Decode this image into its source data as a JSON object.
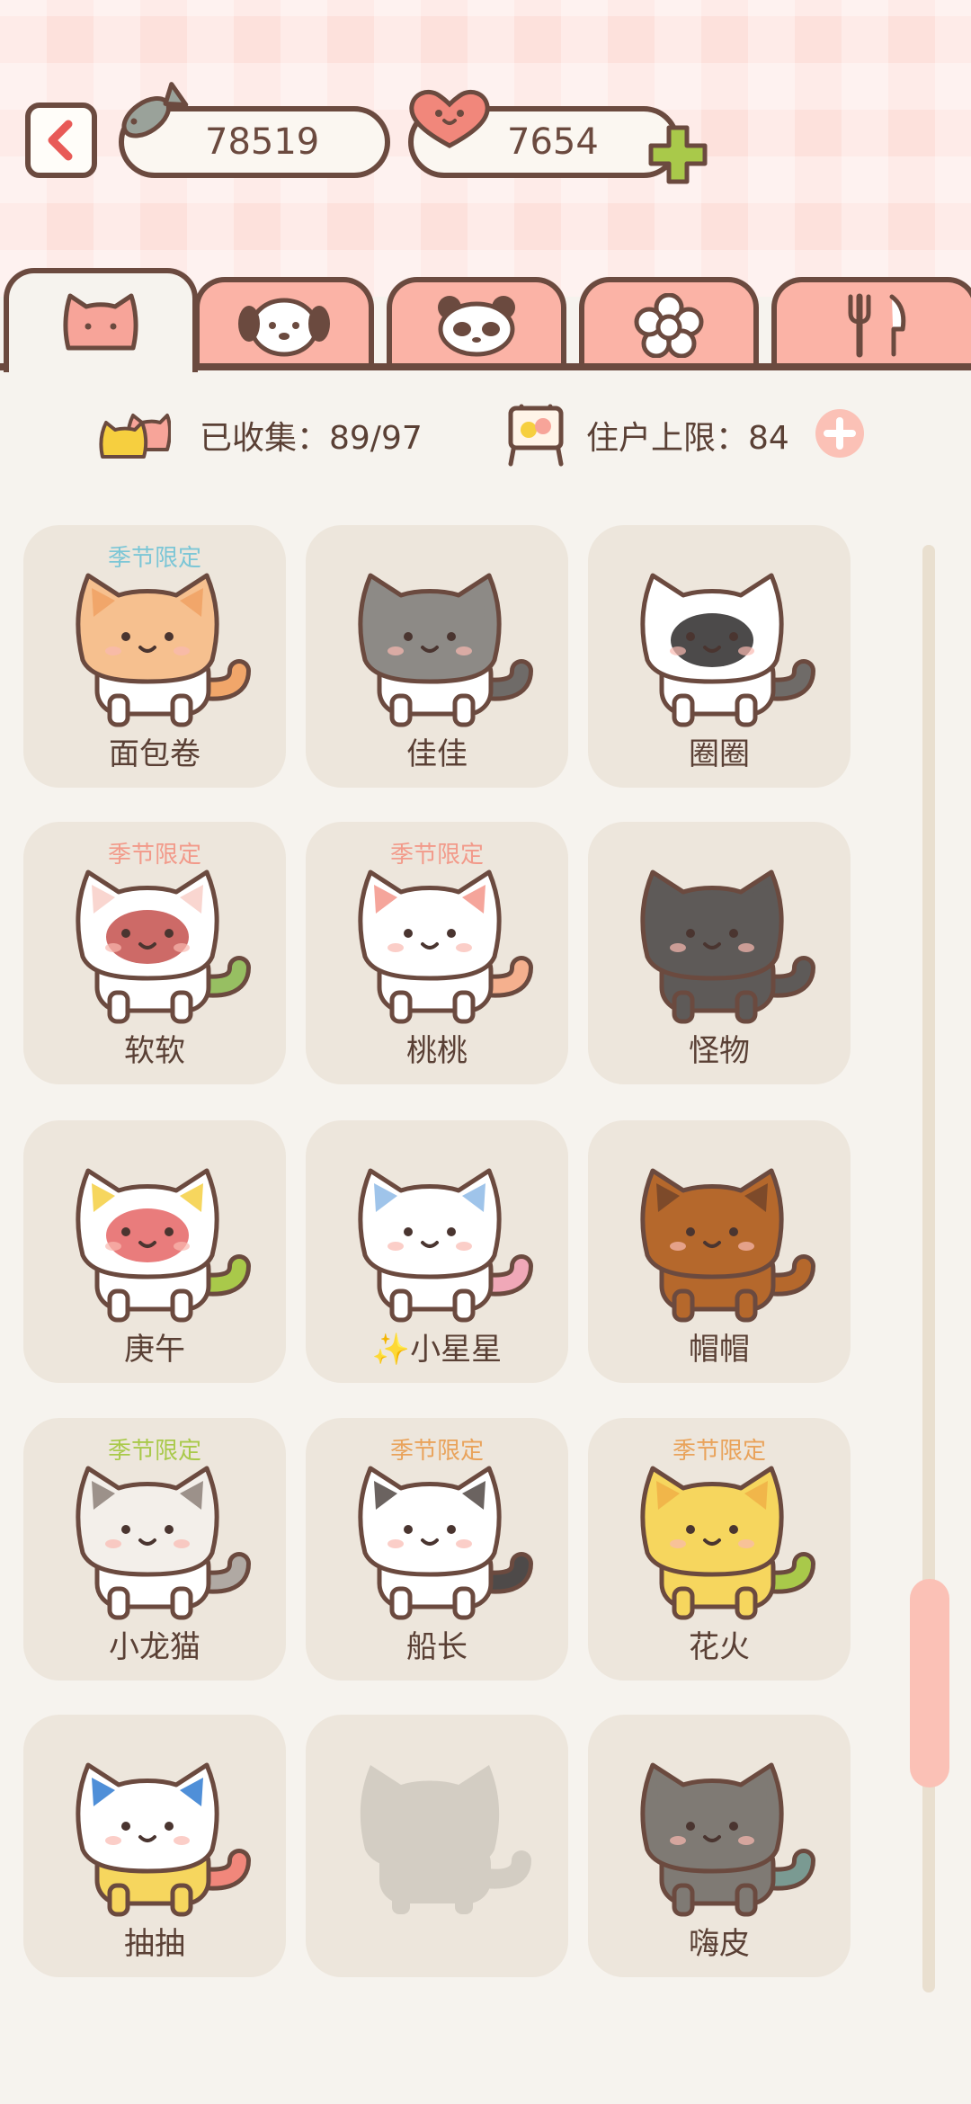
{
  "header": {
    "fish_count": "78519",
    "heart_count": "7654"
  },
  "tabs": [
    {
      "name": "cat",
      "active": true
    },
    {
      "name": "dog",
      "active": false
    },
    {
      "name": "panda",
      "active": false
    },
    {
      "name": "flower",
      "active": false
    },
    {
      "name": "food",
      "active": false
    }
  ],
  "stats": {
    "collected_label": "已收集：89/97",
    "capacity_label": "住户上限：84"
  },
  "colors": {
    "accent_pink": "#fbb3a6",
    "outline_brown": "#6b4a3f",
    "card_bg": "#ede6dc"
  },
  "cards": [
    {
      "name": "面包卷",
      "badge": "季节限定",
      "badge_color": "#7cc6d6"
    },
    {
      "name": "佳佳",
      "badge": "",
      "badge_color": ""
    },
    {
      "name": "圈圈",
      "badge": "",
      "badge_color": ""
    },
    {
      "name": "软软",
      "badge": "季节限定",
      "badge_color": "#f29a8a"
    },
    {
      "name": "桃桃",
      "badge": "季节限定",
      "badge_color": "#f29a8a"
    },
    {
      "name": "怪物",
      "badge": "",
      "badge_color": ""
    },
    {
      "name": "庚午",
      "badge": "",
      "badge_color": ""
    },
    {
      "name": "✨小星星",
      "badge": "",
      "badge_color": ""
    },
    {
      "name": "帽帽",
      "badge": "",
      "badge_color": ""
    },
    {
      "name": "小龙猫",
      "badge": "季节限定",
      "badge_color": "#a9c94a"
    },
    {
      "name": "船长",
      "badge": "季节限定",
      "badge_color": "#e9a35b"
    },
    {
      "name": "花火",
      "badge": "季节限定",
      "badge_color": "#e9a35b"
    },
    {
      "name": "抽抽",
      "badge": "",
      "badge_color": ""
    },
    {
      "name": "",
      "badge": "",
      "badge_color": ""
    },
    {
      "name": "嗨皮",
      "badge": "",
      "badge_color": ""
    }
  ]
}
